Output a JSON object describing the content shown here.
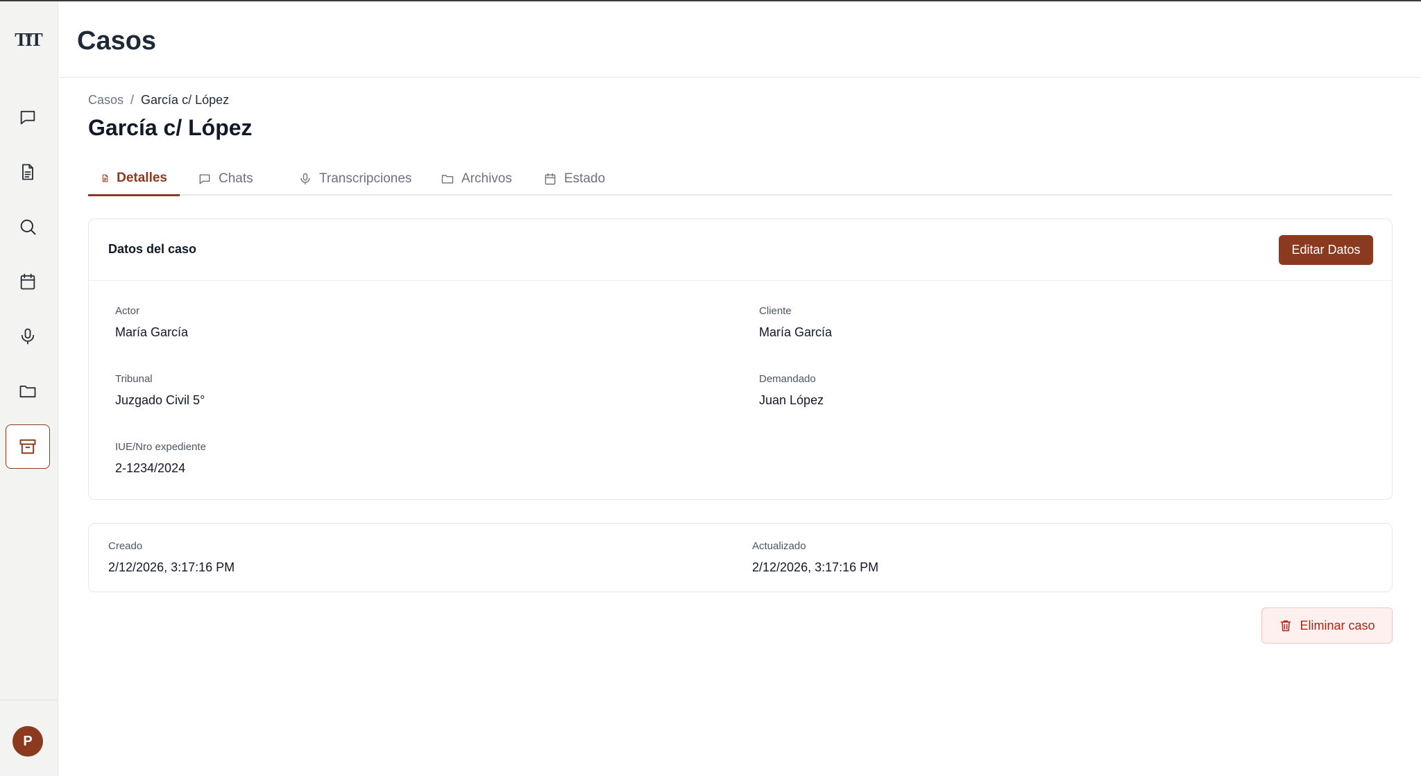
{
  "app": {
    "logo_text": "TIT",
    "icons": [
      "chat-icon",
      "document-icon",
      "search-icon",
      "calendar-icon",
      "microphone-icon",
      "folder-icon",
      "archive-icon"
    ],
    "avatar_initial": "P"
  },
  "header": {
    "title": "Casos"
  },
  "breadcrumb": {
    "root": "Casos",
    "separator": "/",
    "current": "García c/ López"
  },
  "case": {
    "title": "García c/ López"
  },
  "tabs": [
    {
      "label": "Detalles",
      "icon": "document-icon",
      "active": true
    },
    {
      "label": "Chats",
      "icon": "chat-icon",
      "active": false
    },
    {
      "label": "Transcripciones",
      "icon": "microphone-icon",
      "active": false
    },
    {
      "label": "Archivos",
      "icon": "folder-icon",
      "active": false
    },
    {
      "label": "Estado",
      "icon": "calendar-icon",
      "active": false
    }
  ],
  "details_card": {
    "title": "Datos del caso",
    "edit_label": "Editar Datos",
    "fields": {
      "actor": {
        "label": "Actor",
        "value": "María García"
      },
      "cliente": {
        "label": "Cliente",
        "value": "María García"
      },
      "tribunal": {
        "label": "Tribunal",
        "value": "Juzgado Civil 5°"
      },
      "demandado": {
        "label": "Demandado",
        "value": "Juan López"
      },
      "iue": {
        "label": "IUE/Nro expediente",
        "value": "2-1234/2024"
      }
    }
  },
  "meta_card": {
    "created": {
      "label": "Creado",
      "value": "2/12/2026, 3:17:16 PM"
    },
    "updated": {
      "label": "Actualizado",
      "value": "2/12/2026, 3:17:16 PM"
    }
  },
  "delete_label": "Eliminar caso",
  "colors": {
    "accent": "#8b3a1f",
    "danger": "#b42318",
    "danger_bg": "#fdf0ef"
  }
}
